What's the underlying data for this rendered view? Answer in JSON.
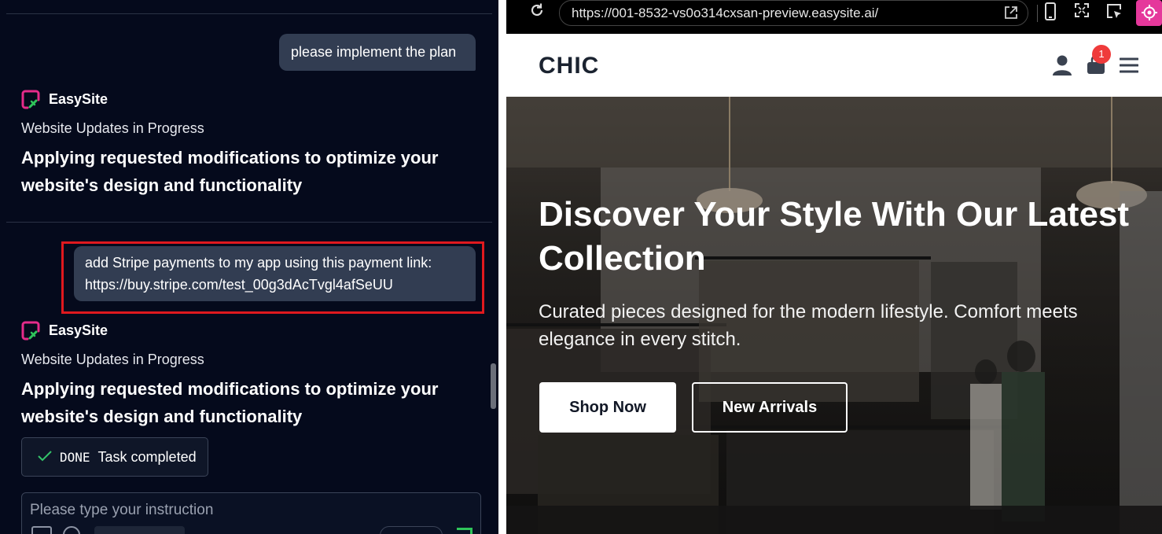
{
  "chat": {
    "messages": [
      {
        "role": "user",
        "text": "please implement the plan"
      },
      {
        "role": "assistant",
        "brand": "EasySite",
        "status": "Website Updates in Progress",
        "title": "Applying requested modifications to optimize your website's design and functionality"
      },
      {
        "role": "user",
        "text_line1": "add Stripe payments to my app using this payment link:",
        "text_line2": "https://buy.stripe.com/test_00g3dAcTvgl4afSeUU"
      },
      {
        "role": "assistant",
        "brand": "EasySite",
        "status": "Website Updates in Progress",
        "title": "Applying requested modifications to optimize your website's design and functionality"
      }
    ],
    "done_badge": {
      "tag": "DONE",
      "label": "Task completed"
    },
    "input_placeholder": "Please type your instruction"
  },
  "browser": {
    "url": "https://001-8532-vs0o314cxsan-preview.easysite.ai/",
    "icons": [
      "reload-icon",
      "open-external-icon",
      "mobile-view-icon",
      "fullscreen-icon",
      "inspect-icon",
      "target-icon"
    ]
  },
  "site": {
    "logo": "CHIC",
    "cart_count": "1",
    "hero": {
      "title": "Discover Your Style With Our Latest Collection",
      "subtitle": "Curated pieces designed for the modern lifestyle. Comfort meets elegance in every stitch.",
      "primary_button": "Shop Now",
      "secondary_button": "New Arrivals"
    }
  },
  "colors": {
    "chat_bg": "#050a1c",
    "user_bubble": "#323d52",
    "highlight": "#e0191e",
    "brand_pink": "#e52b8a",
    "brand_green": "#2fc45a",
    "cart_badge": "#ef3b3b",
    "target_button": "#e5389b"
  }
}
